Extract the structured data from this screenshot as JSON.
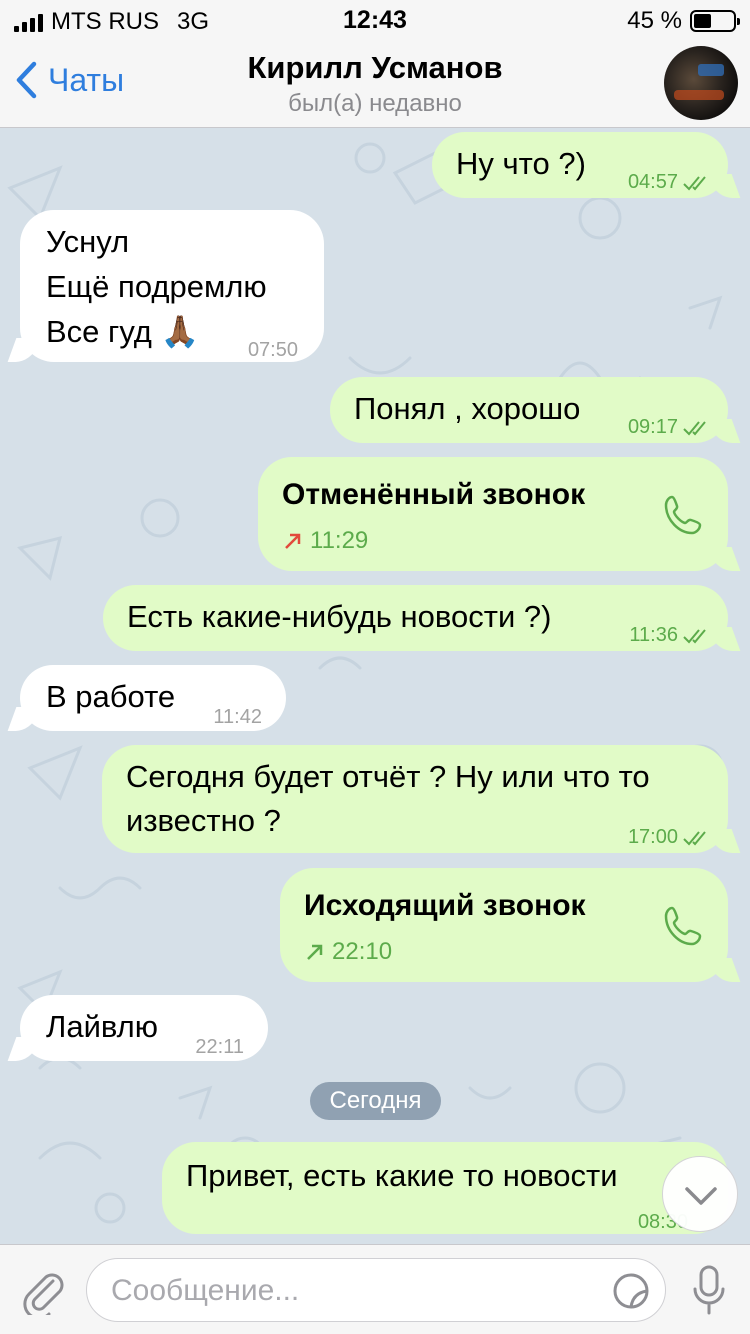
{
  "status_bar": {
    "carrier": "MTS RUS",
    "network": "3G",
    "time": "12:43",
    "battery": "45 %",
    "battery_level": 0.45
  },
  "header": {
    "back_label": "Чаты",
    "contact_name": "Кирилл Усманов",
    "status": "был(а) недавно"
  },
  "messages": [
    {
      "dir": "out",
      "lines": [
        "Ну что ?)"
      ],
      "time": "04:57",
      "read": true
    },
    {
      "dir": "in",
      "lines": [
        "Уснул",
        "Ещё подремлю",
        "Все гуд 🙏🏾"
      ],
      "time": "07:50"
    },
    {
      "dir": "out",
      "lines": [
        "Понял , хорошо"
      ],
      "time": "09:17",
      "read": true
    },
    {
      "dir": "out",
      "type": "call",
      "title": "Отменённый звонок",
      "time": "11:29",
      "arrow_color": "#e24a3b"
    },
    {
      "dir": "out",
      "lines": [
        "Есть какие-нибудь новости ?)"
      ],
      "time": "11:36",
      "read": true
    },
    {
      "dir": "in",
      "lines": [
        "В работе"
      ],
      "time": "11:42"
    },
    {
      "dir": "out",
      "lines": [
        "Сегодня будет отчёт ? Ну или что то",
        "известно ?"
      ],
      "time": "17:00",
      "read": true
    },
    {
      "dir": "out",
      "type": "call",
      "title": "Исходящий звонок",
      "time": "22:10",
      "arrow_color": "#5cab4b"
    },
    {
      "dir": "in",
      "lines": [
        "Лайвлю"
      ],
      "time": "22:11"
    },
    {
      "dir": "date",
      "label": "Сегодня"
    },
    {
      "dir": "out",
      "lines": [
        "Привет,  есть какие то новости"
      ],
      "time": "08:30"
    }
  ],
  "input": {
    "placeholder": "Сообщение..."
  },
  "icons": {
    "back": "chevron-left-icon",
    "attach": "paperclip-icon",
    "sticker": "sticker-icon",
    "mic": "microphone-icon",
    "call": "phone-icon",
    "scroll": "chevron-down-icon"
  },
  "colors": {
    "accent": "#2f7ede",
    "outgoing_bubble": "#e1fbc7",
    "incoming_bubble": "#ffffff",
    "outgoing_meta": "#5cab4b",
    "chat_background": "#d6e0e8"
  }
}
